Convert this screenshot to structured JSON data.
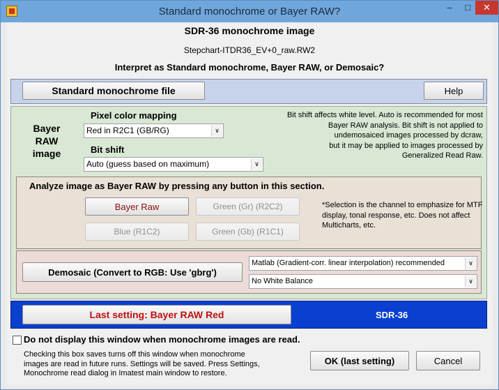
{
  "window": {
    "title": "Standard monochrome or Bayer RAW?",
    "minimize_glyph": "–",
    "maximize_glyph": "□",
    "close_glyph": "✕"
  },
  "header": {
    "title": "SDR-36 monochrome image",
    "filename": "Stepchart-ITDR36_EV+0_raw.RW2",
    "prompt": "Interpret as Standard monochrome, Bayer RAW, or Demosaic?"
  },
  "top_row": {
    "standard_button": "Standard monochrome file",
    "help_button": "Help"
  },
  "bayer_section": {
    "label_line1": "Bayer",
    "label_line2": "RAW",
    "label_line3": "image",
    "pixel_mapping_label": "Pixel color mapping",
    "pixel_mapping_value": "Red in R2C1  (GB/RG)",
    "bit_shift_label": "Bit shift",
    "bit_shift_value": "Auto    (guess based on maximum)",
    "note_line1": "Bit shift affects white level. Auto is recommended for most",
    "note_line2": "Bayer RAW analysis. Bit shift is not applied to",
    "note_line3": "undemosaiced images processed by dcraw,",
    "note_line4": "but it may be applied to images processed by",
    "note_line5": "Generalized Read Raw."
  },
  "analyze_section": {
    "heading": "Analyze image as Bayer RAW by pressing any button in this section.",
    "bayer_raw_button": "Bayer Raw",
    "green_gr_button": "Green (Gr) (R2C2)",
    "blue_button": "Blue  (R1C2)",
    "green_gb_button": "Green (Gb) (R1C1)",
    "note_line1": "*Selection is the channel to emphasize for MTF",
    "note_line2": "display, tonal response, etc. Does not affect",
    "note_line3": "Multicharts, etc."
  },
  "demosaic_section": {
    "button": "Demosaic  (Convert to RGB:  Use 'gbrg')",
    "method_value": "Matlab   (Gradient-corr. linear interpolation)  recommended",
    "white_balance_value": "No White Balance"
  },
  "last_setting": {
    "button": "Last setting:  Bayer RAW Red",
    "right_label": "SDR-36"
  },
  "footer": {
    "checkbox_label": "Do not display this window when monochrome images are read.",
    "checkbox_checked": false,
    "note_line1": "Checking this box saves turns off this window when monochrome",
    "note_line2": "images are read in future runs. Settings will be saved. Press Settings,",
    "note_line3": "Monochrome read dialog in Imatest main window to restore.",
    "ok_button": "OK (last setting)",
    "cancel_button": "Cancel"
  },
  "icons": {
    "dropdown_arrow": "∨"
  },
  "colors": {
    "title_bar": "#6fa6dc",
    "top_panel": "#c6d3eb",
    "bayer_panel": "#d8e8d4",
    "analyze_panel": "#e9e0d6",
    "demosaic_panel": "#ecdbd6",
    "last_setting_panel": "#0a3fd0",
    "red_text": "#8a1010",
    "close_button": "#c7372f"
  }
}
